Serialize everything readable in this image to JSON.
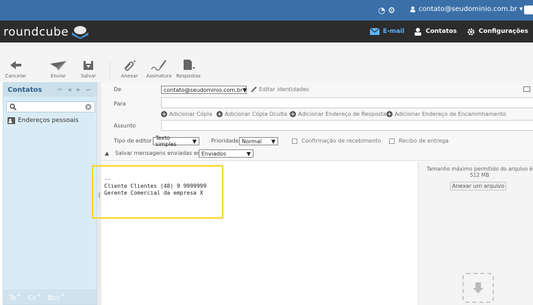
{
  "topbar": {
    "user_email": "contato@seudominio.com.br ▾"
  },
  "header": {
    "logo_text": "roundcube"
  },
  "nav": [
    {
      "label": "E-mail",
      "icon": "envelope-icon"
    },
    {
      "label": "Contatos",
      "icon": "person-icon"
    },
    {
      "label": "Configurações",
      "icon": "gear-icon"
    }
  ],
  "toolbar": {
    "cancel": "Cancelar",
    "send": "Enviar",
    "save": "Salvar",
    "attach": "Anexar",
    "signature": "Assinatura",
    "responses": "Respostas"
  },
  "contacts": {
    "title": "Contatos",
    "pager": "⏮ ◀ ▶ ⏭",
    "search_placeholder": "",
    "addressbook": "Endereços pessoais",
    "recipient_buttons": [
      "To",
      "Cc",
      "Bcc"
    ]
  },
  "compose": {
    "from_label": "De",
    "from_value": "contato@seudominio.com.br",
    "edit_identities": "Editar identidades",
    "to_label": "Para",
    "add_cc": "Adicionar Cópia",
    "add_bcc": "Adicionar Cópia Oculta",
    "add_replyto": "Adicionar Endereço de Resposta",
    "add_followupto": "Adicionar Endereço de Encaminhamento",
    "subject_label": "Assunto",
    "editor_type_label": "Tipo de editor",
    "editor_type_value": "Texto simples",
    "priority_label": "Prioridade",
    "priority_value": "Normal",
    "receipt_label": "Confirmação de recebimento",
    "delivery_label": "Recibo de entrega",
    "save_sent_label": "Salvar mensagens enviadas em",
    "save_sent_value": "Enviados",
    "body": "--\nCliente Clientes (48) 9 9999999\nGerente Comercial da empresa X"
  },
  "attachments": {
    "max_size": "Tamanho máximo permitido do arquivo é\n512 MB",
    "attach_button": "Anexar um arquivo"
  }
}
